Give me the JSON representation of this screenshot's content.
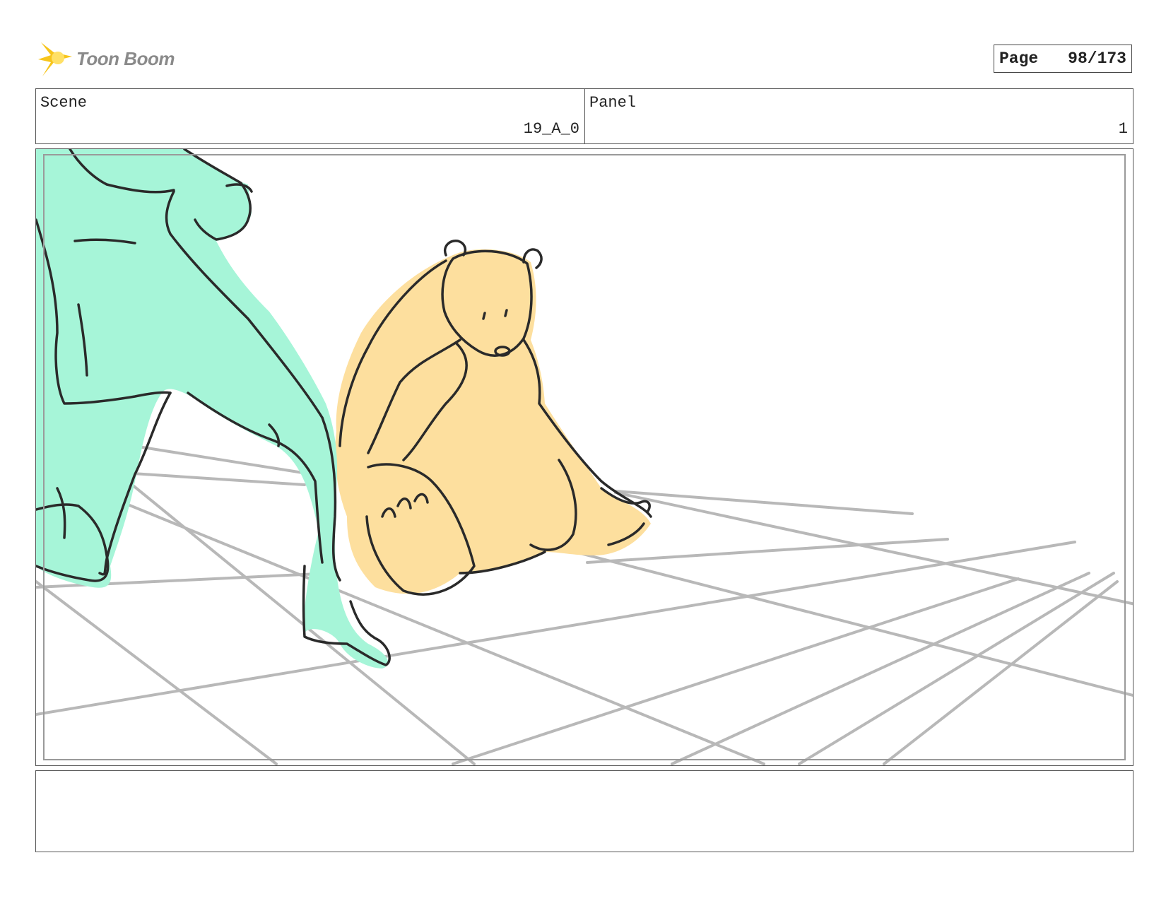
{
  "header": {
    "logo_text": "Toon Boom",
    "page_label": "Page",
    "page_value": "98/173"
  },
  "info": {
    "scene_label": "Scene",
    "scene_value": "19_A_0",
    "panel_label": "Panel",
    "panel_value": "1"
  },
  "notes": {
    "text": ""
  },
  "colors": {
    "figure_fill": "#a6f5d8",
    "bear_fill": "#fddf9e",
    "grid_line": "#b8b8b8",
    "ink": "#2a2a2a",
    "logo_star": "#f7c51b"
  },
  "sketch": {
    "subjects": [
      "figure-silhouette",
      "bear",
      "perspective-floor-grid"
    ]
  }
}
